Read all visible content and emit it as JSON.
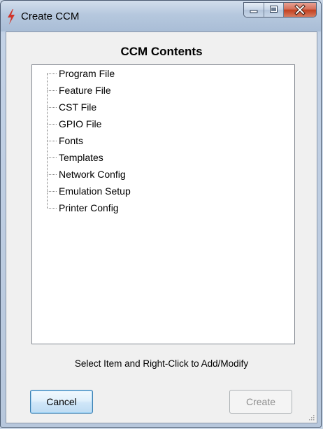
{
  "window": {
    "title": "Create CCM",
    "title_icon": "lightning-icon",
    "caption_buttons": [
      "minimize-icon",
      "maximize-icon",
      "close-icon"
    ]
  },
  "main": {
    "heading": "CCM Contents",
    "tree_items": [
      "Program File",
      "Feature File",
      "CST File",
      "GPIO File",
      "Fonts",
      "Templates",
      "Network Config",
      "Emulation Setup",
      "Printer Config"
    ],
    "hint": "Select Item and Right-Click to Add/Modify"
  },
  "buttons": {
    "cancel_label": "Cancel",
    "create_label": "Create"
  },
  "colors": {
    "accent_border": "#3c7fb1",
    "disabled_text": "#8d8d8d",
    "title_icon": "#d0352a"
  }
}
